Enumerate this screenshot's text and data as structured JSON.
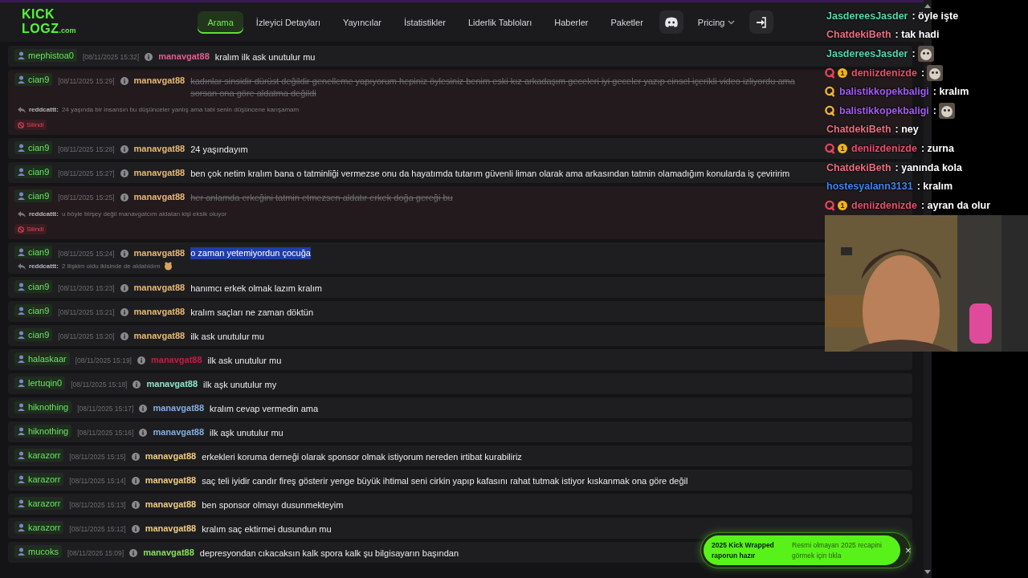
{
  "header": {
    "logo": {
      "top": "KICK",
      "bottom": "LOGZ",
      "suffix": ".com"
    },
    "nav": [
      {
        "label": "Arama",
        "selected": true
      },
      {
        "label": "İzleyici Detayları",
        "selected": false
      },
      {
        "label": "Yayıncılar",
        "selected": false
      },
      {
        "label": "İstatistikler",
        "selected": false
      },
      {
        "label": "Liderlik Tabloları",
        "selected": false
      },
      {
        "label": "Haberler",
        "selected": false
      },
      {
        "label": "Paketler",
        "selected": false
      }
    ],
    "pricing": "Pricing"
  },
  "messages": [
    {
      "channel": "mephistoa0",
      "time": "[08/11/2025 15:32]",
      "user": "manavgat88",
      "color": "#e35d8f",
      "text": "kralım ilk ask unutulur mu",
      "deleted": false,
      "selected": false
    },
    {
      "channel": "cian9",
      "time": "[08/11/2025 15:29]",
      "user": "manavgat88",
      "color": "#e9b872",
      "text": "kadınlar sinsidir dürüst değildir genelleme yapıyorum hepiniz öylesiniz benim eski kız arkadaşım geceleri iyi geceler yazıp cinsel içerikli video izliyordu ama sorsan ona göre aldatma değildi",
      "deleted": true,
      "selected": false,
      "reply": {
        "user": "reddcattt:",
        "text": "24 yaşında bir insansın bu düşünceler yanlış ama tabi senin düşüncene karışamam",
        "emote": false
      },
      "status": "Silindi"
    },
    {
      "channel": "cian9",
      "time": "[08/11/2025 15:28]",
      "user": "manavgat88",
      "color": "#e9b872",
      "text": "24 yaşındayım",
      "deleted": false,
      "selected": false
    },
    {
      "channel": "cian9",
      "time": "[08/11/2025 15:27]",
      "user": "manavgat88",
      "color": "#e9b872",
      "text": "ben çok netim kralım bana o tatminliği vermezse onu da hayatımda tutarım güvenli liman olarak ama arkasından tatmin olamadığım konularda iş çeviririm",
      "deleted": false,
      "selected": false
    },
    {
      "channel": "cian9",
      "time": "[08/11/2025 15:25]",
      "user": "manavgat88",
      "color": "#e9b872",
      "text": "her anlamda erkeğini tatmin etmezsen aldatır erkek doğa gereği bu",
      "deleted": true,
      "selected": false,
      "reply": {
        "user": "reddcattt:",
        "text": "u böyle birşey değil manavgatcım aldatan kişi eksik oluyor",
        "emote": false
      },
      "status": "Silindi"
    },
    {
      "channel": "cian9",
      "time": "[08/11/2025 15:24]",
      "user": "manavgat88",
      "color": "#e9b872",
      "text": "o zaman yetemiyordun çocuğa",
      "deleted": false,
      "selected": true,
      "reply": {
        "user": "reddcattt:",
        "text": "2 ilişkim oldu ikisinde de aldatıldım",
        "emote": true
      }
    },
    {
      "channel": "cian9",
      "time": "[08/11/2025 15:23]",
      "user": "manavgat88",
      "color": "#e9b872",
      "text": "hanımcı erkek olmak lazım kralım",
      "deleted": false,
      "selected": false
    },
    {
      "channel": "cian9",
      "time": "[08/11/2025 15:21]",
      "user": "manavgat88",
      "color": "#e9b872",
      "text": "kralım saçları ne zaman döktün",
      "deleted": false,
      "selected": false
    },
    {
      "channel": "cian9",
      "time": "[08/11/2025 15:20]",
      "user": "manavgat88",
      "color": "#e9b872",
      "text": "ilk ask unutulur mu",
      "deleted": false,
      "selected": false
    },
    {
      "channel": "halaskaar",
      "time": "[08/11/2025 15:19]",
      "user": "manavgat88",
      "color": "#c21f45",
      "text": "ilk ask unutulur mu",
      "deleted": false,
      "selected": false
    },
    {
      "channel": "lertuqin0",
      "time": "[08/11/2025 15:18]",
      "user": "manavgat88",
      "color": "#8fe3c4",
      "text": "ilk aşk unutulur my",
      "deleted": false,
      "selected": false
    },
    {
      "channel": "hiknothing",
      "time": "[08/11/2025 15:17]",
      "user": "manavgat88",
      "color": "#82aee0",
      "text": "kralım cevap vermedin ama",
      "deleted": false,
      "selected": false
    },
    {
      "channel": "hiknothing",
      "time": "[08/11/2025 15:16]",
      "user": "manavgat88",
      "color": "#82aee0",
      "text": "ilk aşk unutulur mu",
      "deleted": false,
      "selected": false
    },
    {
      "channel": "karazorr",
      "time": "[08/11/2025 15:15]",
      "user": "manavgat88",
      "color": "#f2cc80",
      "text": "erkekleri koruma derneği olarak sponsor olmak istiyorum nereden irtibat kurabiliriz",
      "deleted": false,
      "selected": false
    },
    {
      "channel": "karazorr",
      "time": "[08/11/2025 15:14]",
      "user": "manavgat88",
      "color": "#f2cc80",
      "text": "saç teli iyidir candır fireş gösterir yenge büyük ihtimal seni cirkin yapıp kafasını rahat tutmak istiyor kıskanmak ona göre değil",
      "deleted": false,
      "selected": false
    },
    {
      "channel": "karazorr",
      "time": "[08/11/2025 15:13]",
      "user": "manavgat88",
      "color": "#f2cc80",
      "text": "ben sponsor olmayı dusunmekteyim",
      "deleted": false,
      "selected": false
    },
    {
      "channel": "karazorr",
      "time": "[08/11/2025 15:12]",
      "user": "manavgat88",
      "color": "#f2cc80",
      "text": "kralım saç ektirmei dusundun mu",
      "deleted": false,
      "selected": false
    },
    {
      "channel": "mucoks",
      "time": "[08/11/2025 15:09]",
      "user": "manavgat88",
      "color": "#86e05a",
      "text": "depresyondan cıkacaksın kalk spora kalk şu bilgisayarın başından",
      "deleted": false,
      "selected": false
    }
  ],
  "toast": {
    "title": "2025 Kick Wrapped raporun hazır",
    "text": "Resmi olmayan 2025 recapini görmek için tıkla",
    "close": "×"
  },
  "stream_chat": [
    {
      "user": "JasdereesJasder",
      "color": "#52d9aa",
      "text": ": öyle işte"
    },
    {
      "user": "ChatdekiBeth",
      "color": "#ea6f82",
      "text": ": tak hadi"
    },
    {
      "user": "JasdereesJasder",
      "color": "#52d9aa",
      "text": ":",
      "kind": "emote"
    },
    {
      "user": "deniizdenizde",
      "color": "#ea4f6e",
      "badges": [
        {
          "kind": "q",
          "color": "#e8435a"
        },
        {
          "kind": "coin",
          "label": "1"
        }
      ],
      "text": ":",
      "kind": "emote"
    },
    {
      "user": "balistikkopekbaligi",
      "color": "#a25cf5",
      "badges": [
        {
          "kind": "q",
          "color": "#f0b43c"
        }
      ],
      "text": ": kralım"
    },
    {
      "user": "balistikkopekbaligi",
      "color": "#a25cf5",
      "badges": [
        {
          "kind": "q",
          "color": "#f0b43c"
        }
      ],
      "text": ":",
      "kind": "emote"
    },
    {
      "user": "ChatdekiBeth",
      "color": "#ea6f82",
      "text": ": ney"
    },
    {
      "user": "deniizdenizde",
      "color": "#ea4f6e",
      "badges": [
        {
          "kind": "q",
          "color": "#e8435a"
        },
        {
          "kind": "coin",
          "label": "1"
        }
      ],
      "text": ": zurna"
    },
    {
      "user": "ChatdekiBeth",
      "color": "#ea6f82",
      "text": ": yanında kola"
    },
    {
      "user": "hostesyalann3131",
      "color": "#3f86f0",
      "text": ": kralım"
    },
    {
      "user": "deniizdenizde",
      "color": "#ea4f6e",
      "badges": [
        {
          "kind": "q",
          "color": "#e8435a"
        },
        {
          "kind": "coin",
          "label": "1"
        }
      ],
      "text": ": ayran da olur"
    }
  ]
}
